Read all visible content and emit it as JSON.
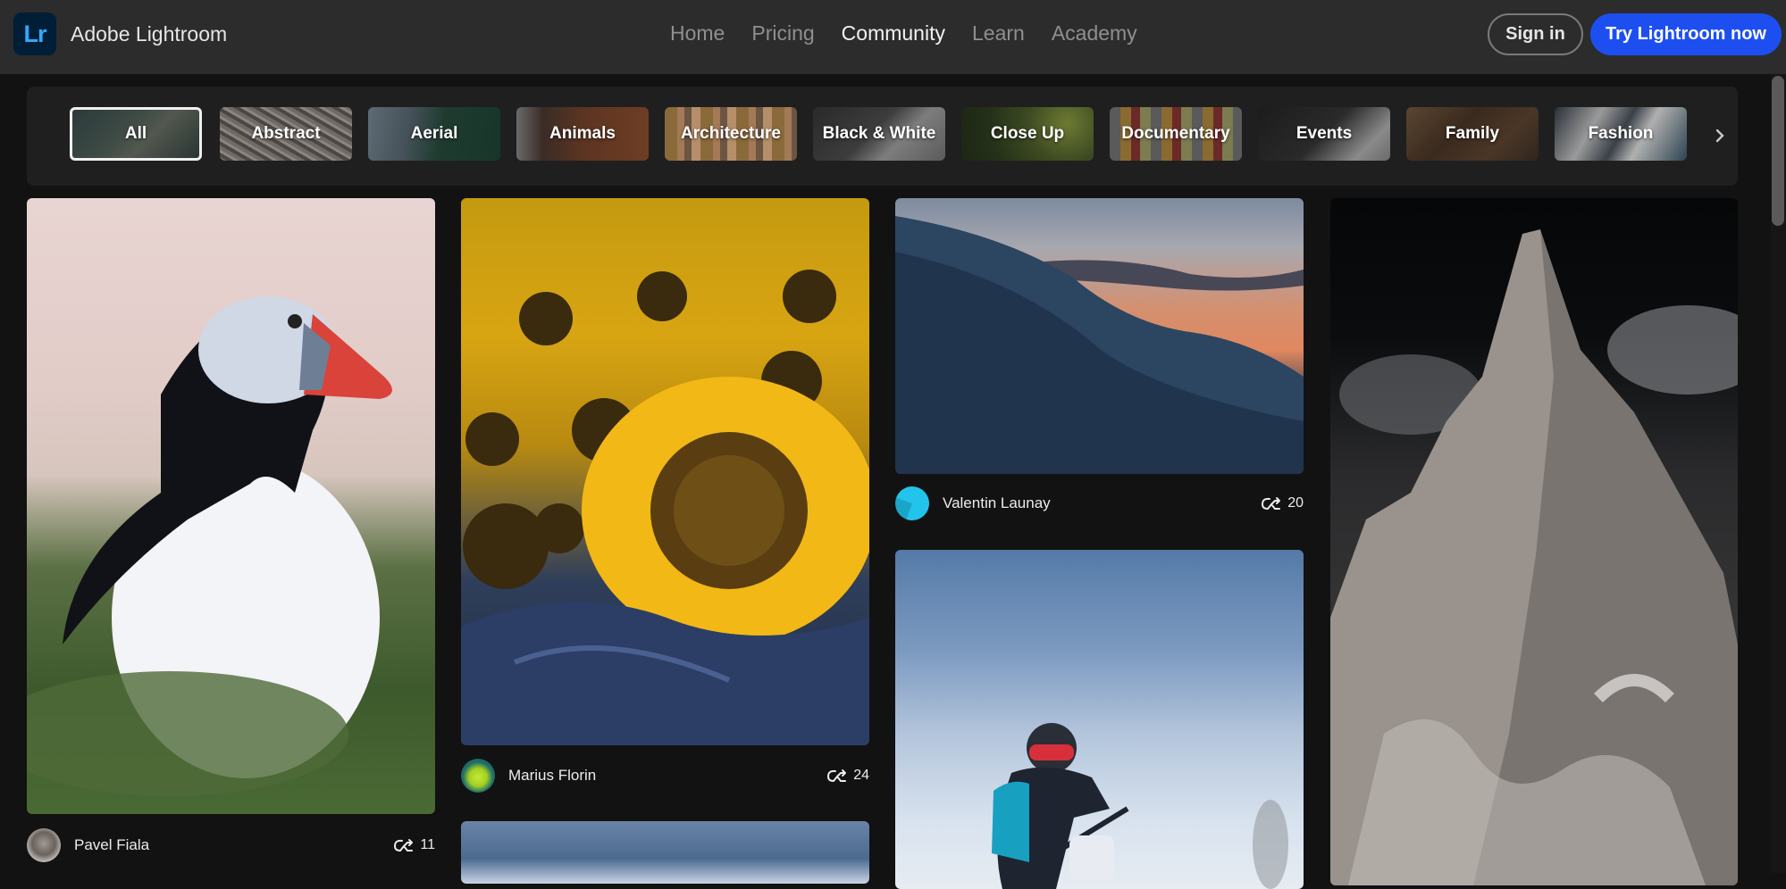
{
  "header": {
    "logo_text": "Lr",
    "brand": "Adobe Lightroom",
    "nav": [
      {
        "label": "Home",
        "active": false
      },
      {
        "label": "Pricing",
        "active": false
      },
      {
        "label": "Community",
        "active": true
      },
      {
        "label": "Learn",
        "active": false
      },
      {
        "label": "Academy",
        "active": false
      }
    ],
    "signin_label": "Sign in",
    "try_label": "Try Lightroom now",
    "accent": "#1d4ff0"
  },
  "categories": {
    "items": [
      {
        "label": "All",
        "active": true
      },
      {
        "label": "Abstract"
      },
      {
        "label": "Aerial"
      },
      {
        "label": "Animals"
      },
      {
        "label": "Architecture"
      },
      {
        "label": "Black & White"
      },
      {
        "label": "Close Up"
      },
      {
        "label": "Documentary"
      },
      {
        "label": "Events"
      },
      {
        "label": "Family"
      },
      {
        "label": "Fashion"
      }
    ],
    "next_icon": "chevron-right-icon"
  },
  "gallery": {
    "cards": [
      {
        "author": "Pavel Fiala",
        "remixes": "11",
        "subject": "puffin"
      },
      {
        "author": "Marius Florin",
        "remixes": "24",
        "subject": "sunflowers"
      },
      {
        "author": "Valentin Launay",
        "remixes": "20",
        "subject": "wave"
      },
      {
        "author": "",
        "remixes": "",
        "subject": "motocross"
      },
      {
        "author": "",
        "remixes": "",
        "subject": "mountain"
      },
      {
        "author": "",
        "remixes": "",
        "subject": "blue-abstract"
      }
    ],
    "remix_icon": "remix-icon"
  }
}
